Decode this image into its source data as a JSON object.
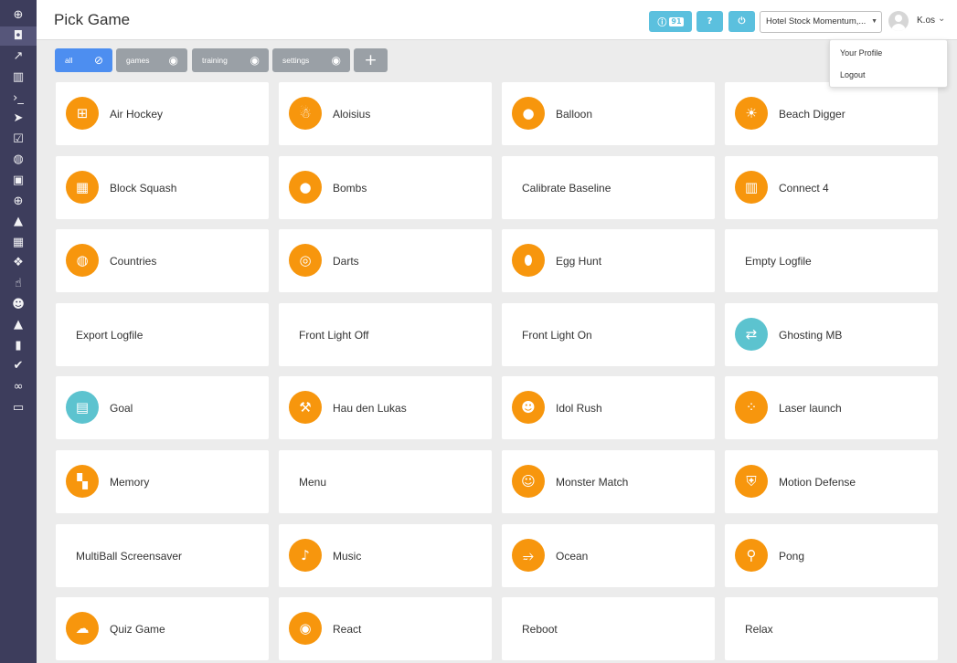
{
  "header": {
    "title": "Pick Game",
    "info_count": "91",
    "hotel": "Hotel Stock Momentum,...",
    "user": "K.os"
  },
  "user_menu": {
    "profile": "Your Profile",
    "logout": "Logout"
  },
  "filters": [
    {
      "label": "all",
      "icon": "eye-off-icon",
      "active": true
    },
    {
      "label": "games",
      "icon": "eye-icon"
    },
    {
      "label": "training",
      "icon": "eye-icon"
    },
    {
      "label": "settings",
      "icon": "eye-icon"
    }
  ],
  "sidebar_icons": [
    "dashboard-icon",
    "gamepad-icon",
    "line-chart-icon",
    "bar-chart-icon",
    "terminal-icon",
    "location-arrow-icon",
    "check-square-icon",
    "globe-icon",
    "image-icon",
    "dashboard-icon-2",
    "warning-icon",
    "calendar-icon",
    "cubes-icon",
    "thumbs-up-icon",
    "users-icon",
    "area-chart-icon",
    "mobile-icon",
    "check-icon",
    "link-icon",
    "credit-card-icon"
  ],
  "games": [
    {
      "label": "Air Hockey",
      "icon": "air-hockey-icon",
      "glyph": "⊞"
    },
    {
      "label": "Aloisius",
      "icon": "aloisius-icon",
      "glyph": "☃"
    },
    {
      "label": "Balloon",
      "icon": "balloon-icon",
      "glyph": "●"
    },
    {
      "label": "Beach Digger",
      "icon": "beach-digger-icon",
      "glyph": "☀"
    },
    {
      "label": "Block Squash",
      "icon": "block-squash-icon",
      "glyph": "▦"
    },
    {
      "label": "Bombs",
      "icon": "bomb-icon",
      "glyph": "●"
    },
    {
      "label": "Calibrate Baseline"
    },
    {
      "label": "Connect 4",
      "icon": "connect-four-icon",
      "glyph": "▥"
    },
    {
      "label": "Countries",
      "icon": "globe-icon",
      "glyph": "◍"
    },
    {
      "label": "Darts",
      "icon": "dartboard-icon",
      "glyph": "◎"
    },
    {
      "label": "Egg Hunt",
      "icon": "egg-icon",
      "glyph": "⬮"
    },
    {
      "label": "Empty Logfile"
    },
    {
      "label": "Export Logfile"
    },
    {
      "label": "Front Light Off"
    },
    {
      "label": "Front Light On"
    },
    {
      "label": "Ghosting MB",
      "icon": "swap-arrows-icon",
      "glyph": "⇄",
      "teal": true
    },
    {
      "label": "Goal",
      "icon": "goal-net-icon",
      "glyph": "▤",
      "teal": true
    },
    {
      "label": "Hau den Lukas",
      "icon": "hammer-icon",
      "glyph": "⚒"
    },
    {
      "label": "Idol Rush",
      "icon": "idol-mask-icon",
      "glyph": "☻"
    },
    {
      "label": "Laser launch",
      "icon": "laser-dots-icon",
      "glyph": "⁘"
    },
    {
      "label": "Memory",
      "icon": "memory-cards-icon",
      "glyph": "▚"
    },
    {
      "label": "Menu"
    },
    {
      "label": "Monster Match",
      "icon": "monster-face-icon",
      "glyph": "☺"
    },
    {
      "label": "Motion Defense",
      "icon": "shield-icon",
      "glyph": "⛨"
    },
    {
      "label": "MultiBall Screensaver"
    },
    {
      "label": "Music",
      "icon": "music-note-icon",
      "glyph": "♪"
    },
    {
      "label": "Ocean",
      "icon": "fish-icon",
      "glyph": "⥴"
    },
    {
      "label": "Pong",
      "icon": "pong-icon",
      "glyph": "⚲"
    },
    {
      "label": "Quiz Game",
      "icon": "quiz-bubble-icon",
      "glyph": "☁"
    },
    {
      "label": "React",
      "icon": "react-rings-icon",
      "glyph": "◉"
    },
    {
      "label": "Reboot"
    },
    {
      "label": "Relax"
    }
  ]
}
